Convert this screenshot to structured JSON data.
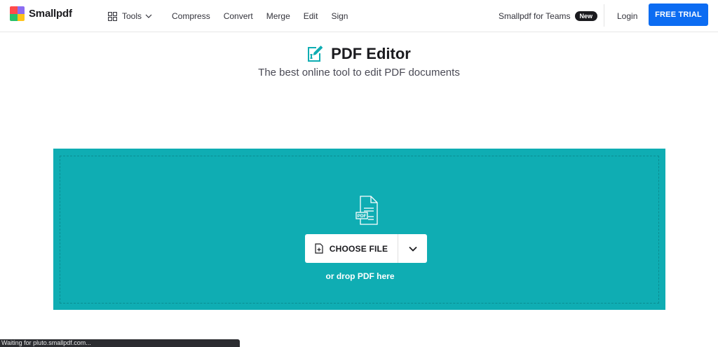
{
  "brand": {
    "name": "Smallpdf",
    "logo_colors": [
      "#ff4b4b",
      "#8c6cf2",
      "#27c06a",
      "#ffc41a"
    ]
  },
  "nav": {
    "tools_label": "Tools",
    "links": [
      "Compress",
      "Convert",
      "Merge",
      "Edit",
      "Sign"
    ]
  },
  "header_right": {
    "teams_label": "Smallpdf for Teams",
    "teams_badge": "New",
    "login_label": "Login",
    "trial_label": "FREE TRIAL"
  },
  "hero": {
    "title": "PDF Editor",
    "subtitle": "The best online tool to edit PDF documents"
  },
  "dropzone": {
    "file_badge": "PDF",
    "choose_label": "CHOOSE FILE",
    "hint": "or drop PDF here",
    "bg_color": "#0fadb3"
  },
  "status_bar": {
    "text": "Waiting for pluto.smallpdf.com..."
  },
  "colors": {
    "accent_blue": "#0c6cf2",
    "teal": "#0fadb3"
  }
}
